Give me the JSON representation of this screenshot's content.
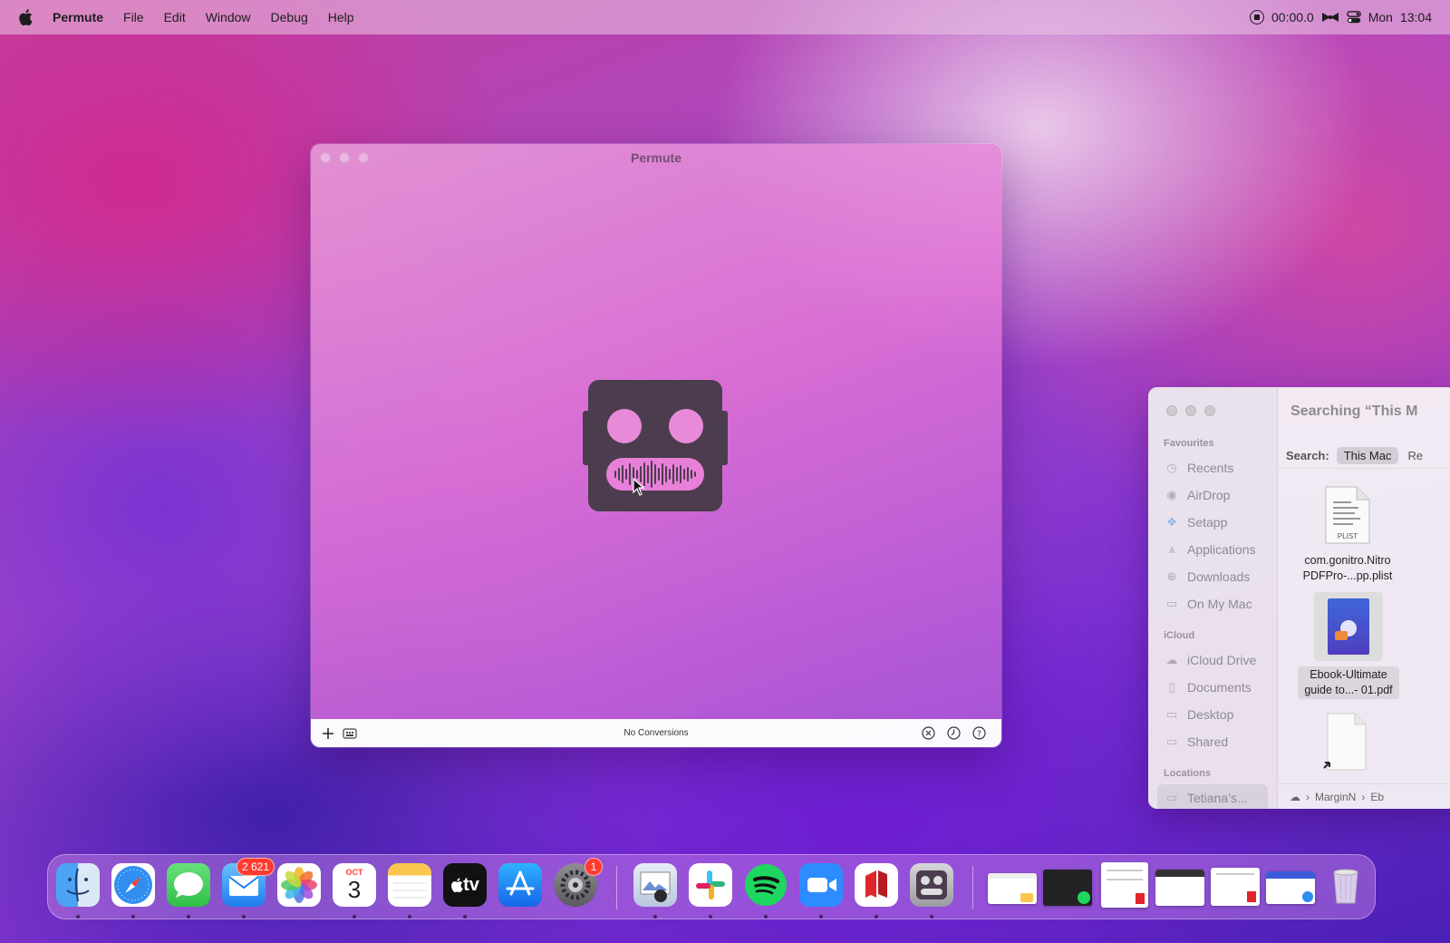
{
  "menubar": {
    "app_name": "Permute",
    "items": [
      "File",
      "Edit",
      "Window",
      "Debug",
      "Help"
    ],
    "recording_time": "00:00.0",
    "day": "Mon",
    "time": "13:04"
  },
  "permute": {
    "title": "Permute",
    "status": "No Conversions"
  },
  "finder": {
    "search_title": "Searching “This M",
    "search_label": "Search:",
    "scope_selected": "This Mac",
    "scope_other": "Re",
    "favourites_title": "Favourites",
    "favourites": [
      "Recents",
      "AirDrop",
      "Setapp",
      "Applications",
      "Downloads",
      "On My Mac"
    ],
    "icloud_title": "iCloud",
    "icloud": [
      "iCloud Drive",
      "Documents",
      "Desktop",
      "Shared"
    ],
    "locations_title": "Locations",
    "locations": [
      "Tetiana’s..."
    ],
    "files": [
      {
        "line1": "com.gonitro.Nitro",
        "line2": "PDFPro-...pp.plist",
        "type_label": "PLIST"
      },
      {
        "line1": "Ebook-Ultimate",
        "line2": "guide to...- 01.pdf"
      }
    ],
    "path": [
      "MarginN",
      "Eb"
    ]
  },
  "dock": {
    "mail_badge": "2 621",
    "settings_badge": "1",
    "calendar_month": "OCT",
    "calendar_day": "3",
    "tv_label": "tv"
  },
  "colors": {
    "accent_red": "#ff3b30",
    "robot": "#4b3d4e",
    "robot_mouth": "#e87fd8"
  }
}
